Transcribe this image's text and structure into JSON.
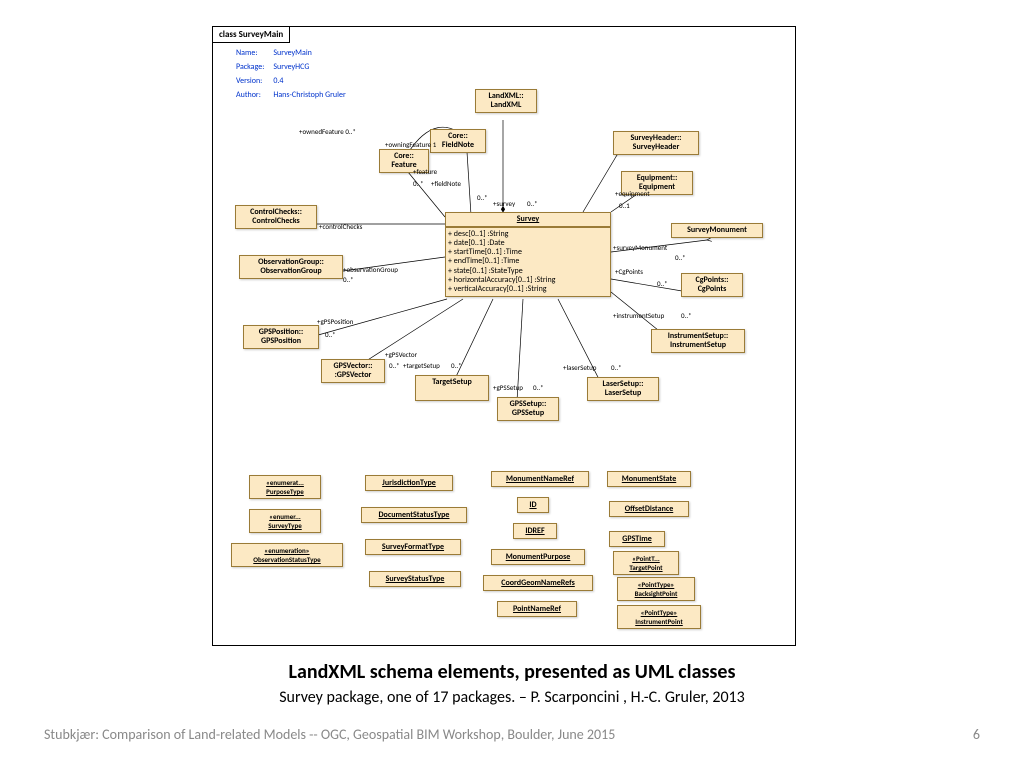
{
  "frame_tab": "class SurveyMain",
  "meta": {
    "k1": "Name:",
    "v1": "SurveyMain",
    "k2": "Package:",
    "v2": "SurveyHCG",
    "k3": "Version:",
    "v3": "0.4",
    "k4": "Author:",
    "v4": "Hans-Christoph Gruler"
  },
  "boxes": {
    "landxml": "LandXML::\nLandXML",
    "fieldnote": "Core::\nFieldNote",
    "feature": "Core::\nFeature",
    "controlchecks": "ControlChecks::\nControlChecks",
    "surveyheader": "SurveyHeader::\nSurveyHeader",
    "equipment": "Equipment::\nEquipment",
    "observationgroup": "ObservationGroup::\nObservationGroup",
    "survey_hdr": "Survey",
    "surveymonument": "SurveyMonument",
    "cgpoints": "CgPoints::\nCgPoints",
    "gpsposition": "GPSPosition::\nGPSPosition",
    "gpsvector": "GPSVector::\n:GPSVector",
    "targetsetup": "TargetSetup",
    "gpssetup": "GPSSetup::\nGPSSetup",
    "lasersetup": "LaserSetup::\nLaserSetup",
    "instrumentsetup": "InstrumentSetup::\nInstrumentSetup"
  },
  "attrs": [
    "+   desc[0..1] :String",
    "+   date[0..1] :Date",
    "+   startTime[0..1] :Time",
    "+   endTime[0..1] :Time",
    "+   state[0..1] :StateType",
    "+   horizontalAccuracy[0..1] :String",
    "+   verticalAccuracy[0..1] :String"
  ],
  "rel": {
    "ownedFeature": "+ownedFeature 0..*",
    "owningFeature": "+owningFeature 1",
    "feature": "+feature",
    "fieldNote": "+fieldNote",
    "controlChecks": "+controlChecks",
    "observationGroup": "+observationGroup",
    "gpsPosition": "+gPSPosition",
    "gpsVector": "+gPSVector",
    "targetSetup": "+targetSetup",
    "gpsSetup": "+gPSSetup",
    "laserSetup": "+laserSetup",
    "instrumentSetup": "+instrumentSetup",
    "surveyMonument": "+surveyMonument",
    "cgPoints": "+CgPoints",
    "equipment": "+equipment",
    "survey": "+survey",
    "m0s": "0..*",
    "m01": "0..1",
    "m0s2": "0..*"
  },
  "lower": {
    "purposetype": {
      "s": "«enumerat...",
      "t": "PurposeType"
    },
    "surveytype": {
      "s": "«enumer...",
      "t": "SurveyType"
    },
    "obsstatus": {
      "s": "«enumeration»",
      "t": "ObservationStatusType"
    },
    "jurisdiction": "JurisdictionType",
    "docstatus": "DocumentStatusType",
    "surveyformat": "SurveyFormatType",
    "surveystatus": "SurveyStatusType",
    "monnameref": "MonumentNameRef",
    "id": "ID",
    "idref": "IDREF",
    "monpurpose": "MonumentPurpose",
    "coordgeom": "CoordGeomNameRefs",
    "pointnameref": "PointNameRef",
    "monstate": "MonumentState",
    "offsetdist": "OffsetDistance",
    "gpstime": "GPSTime",
    "targetpoint": {
      "s": "«PointT...",
      "t": "TargetPoint"
    },
    "backsight": {
      "s": "«PointType»",
      "t": "BacksightPoint"
    },
    "instrpoint": {
      "s": "«PointType»",
      "t": "InstrumentPoint"
    }
  },
  "caption1": "LandXML schema elements, presented as UML classes",
  "caption2": "Survey package, one of 17 packages. – P. Scarponcini , H.-C. Gruler, 2013",
  "footerL": "Stubkjær: Comparison of Land-related Models   --   OGC, Geospatial BIM Workshop, Boulder, June 2015",
  "footerR": "6"
}
